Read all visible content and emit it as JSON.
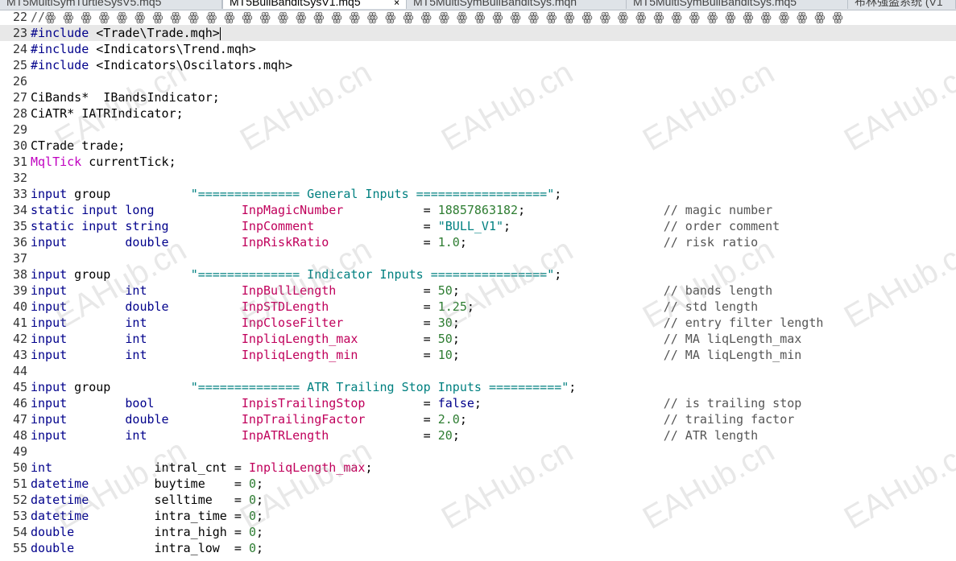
{
  "tabs": [
    {
      "label": "MT5MultiSymTurtleSysV5.mq5",
      "active": false
    },
    {
      "label": "MT5BullBanditSysV1.mq5",
      "active": true
    },
    {
      "label": "MT5MultiSymBullBanditSys.mqh",
      "active": false
    },
    {
      "label": "MT5MultiSymBullBanditSys.mq5",
      "active": false
    },
    {
      "label": "布林强盗系统 (V1",
      "active": false
    }
  ],
  "tab_close_icon": "×",
  "watermark_text": "EAHub.cn",
  "lines": [
    {
      "n": "22",
      "segs": [
        {
          "t": "//ꙮ ꙮ ꙮ ꙮ ꙮ ꙮ ꙮ ꙮ ꙮ ꙮ ꙮ ꙮ ꙮ ꙮ ꙮ ꙮ ꙮ ꙮ ꙮ ꙮ ꙮ ꙮ ꙮ ꙮ ꙮ ꙮ ꙮ ꙮ ꙮ ꙮ ꙮ ꙮ ꙮ ꙮ ꙮ ꙮ ꙮ ꙮ ꙮ ꙮ ꙮ ꙮ ꙮ ꙮ ꙮ",
          "c": "cm"
        }
      ]
    },
    {
      "n": "23",
      "current": true,
      "segs": [
        {
          "t": "#include",
          "c": "pp"
        },
        {
          "t": " <Trade\\Trade.mqh>"
        }
      ]
    },
    {
      "n": "24",
      "segs": [
        {
          "t": "#include",
          "c": "pp"
        },
        {
          "t": " <Indicators\\Trend.mqh>"
        }
      ]
    },
    {
      "n": "25",
      "segs": [
        {
          "t": "#include",
          "c": "pp"
        },
        {
          "t": " <Indicators\\Oscilators.mqh>"
        }
      ]
    },
    {
      "n": "26",
      "segs": []
    },
    {
      "n": "27",
      "segs": [
        {
          "t": "CiBands*  IBandsIndicator;"
        }
      ]
    },
    {
      "n": "28",
      "segs": [
        {
          "t": "CiATR* IATRIndicator;"
        }
      ]
    },
    {
      "n": "29",
      "segs": []
    },
    {
      "n": "30",
      "segs": [
        {
          "t": "CTrade trade;"
        }
      ]
    },
    {
      "n": "31",
      "segs": [
        {
          "t": "MqlTick",
          "c": "mq"
        },
        {
          "t": " currentTick;"
        }
      ]
    },
    {
      "n": "32",
      "segs": []
    },
    {
      "n": "33",
      "segs": [
        {
          "t": "input",
          "c": "kw"
        },
        {
          "t": " group           "
        },
        {
          "t": "\"============== General Inputs ==================\"",
          "c": "st"
        },
        {
          "t": ";"
        }
      ]
    },
    {
      "n": "34",
      "segs": [
        {
          "t": "static",
          "c": "kw"
        },
        {
          "t": " "
        },
        {
          "t": "input",
          "c": "kw"
        },
        {
          "t": " "
        },
        {
          "t": "long",
          "c": "ty"
        },
        {
          "t": "            "
        },
        {
          "t": "InpMagicNumber",
          "c": "id"
        },
        {
          "t": "           = "
        },
        {
          "t": "18857863182",
          "c": "nu"
        },
        {
          "t": ";                   "
        },
        {
          "t": "// magic number",
          "c": "cm"
        }
      ]
    },
    {
      "n": "35",
      "segs": [
        {
          "t": "static",
          "c": "kw"
        },
        {
          "t": " "
        },
        {
          "t": "input",
          "c": "kw"
        },
        {
          "t": " "
        },
        {
          "t": "string",
          "c": "ty"
        },
        {
          "t": "          "
        },
        {
          "t": "InpComment",
          "c": "id"
        },
        {
          "t": "               = "
        },
        {
          "t": "\"BULL_V1\"",
          "c": "st"
        },
        {
          "t": ";                     "
        },
        {
          "t": "// order comment",
          "c": "cm"
        }
      ]
    },
    {
      "n": "36",
      "segs": [
        {
          "t": "input",
          "c": "kw"
        },
        {
          "t": "        "
        },
        {
          "t": "double",
          "c": "ty"
        },
        {
          "t": "          "
        },
        {
          "t": "InpRiskRatio",
          "c": "id"
        },
        {
          "t": "             = "
        },
        {
          "t": "1.0",
          "c": "nu"
        },
        {
          "t": ";                           "
        },
        {
          "t": "// risk ratio",
          "c": "cm"
        }
      ]
    },
    {
      "n": "37",
      "segs": []
    },
    {
      "n": "38",
      "segs": [
        {
          "t": "input",
          "c": "kw"
        },
        {
          "t": " group           "
        },
        {
          "t": "\"============== Indicator Inputs ================\"",
          "c": "st"
        },
        {
          "t": ";"
        }
      ]
    },
    {
      "n": "39",
      "segs": [
        {
          "t": "input",
          "c": "kw"
        },
        {
          "t": "        "
        },
        {
          "t": "int",
          "c": "ty"
        },
        {
          "t": "             "
        },
        {
          "t": "InpBullLength",
          "c": "id"
        },
        {
          "t": "            = "
        },
        {
          "t": "50",
          "c": "nu"
        },
        {
          "t": ";                            "
        },
        {
          "t": "// bands length",
          "c": "cm"
        }
      ]
    },
    {
      "n": "40",
      "segs": [
        {
          "t": "input",
          "c": "kw"
        },
        {
          "t": "        "
        },
        {
          "t": "double",
          "c": "ty"
        },
        {
          "t": "          "
        },
        {
          "t": "InpSTDLength",
          "c": "id"
        },
        {
          "t": "             = "
        },
        {
          "t": "1.25",
          "c": "nu"
        },
        {
          "t": ";                          "
        },
        {
          "t": "// std length",
          "c": "cm"
        }
      ]
    },
    {
      "n": "41",
      "segs": [
        {
          "t": "input",
          "c": "kw"
        },
        {
          "t": "        "
        },
        {
          "t": "int",
          "c": "ty"
        },
        {
          "t": "             "
        },
        {
          "t": "InpCloseFilter",
          "c": "id"
        },
        {
          "t": "           = "
        },
        {
          "t": "30",
          "c": "nu"
        },
        {
          "t": ";                            "
        },
        {
          "t": "// entry filter length",
          "c": "cm"
        }
      ]
    },
    {
      "n": "42",
      "segs": [
        {
          "t": "input",
          "c": "kw"
        },
        {
          "t": "        "
        },
        {
          "t": "int",
          "c": "ty"
        },
        {
          "t": "             "
        },
        {
          "t": "InpliqLength_max",
          "c": "id"
        },
        {
          "t": "         = "
        },
        {
          "t": "50",
          "c": "nu"
        },
        {
          "t": ";                            "
        },
        {
          "t": "// MA liqLength_max",
          "c": "cm"
        }
      ]
    },
    {
      "n": "43",
      "segs": [
        {
          "t": "input",
          "c": "kw"
        },
        {
          "t": "        "
        },
        {
          "t": "int",
          "c": "ty"
        },
        {
          "t": "             "
        },
        {
          "t": "InpliqLength_min",
          "c": "id"
        },
        {
          "t": "         = "
        },
        {
          "t": "10",
          "c": "nu"
        },
        {
          "t": ";                            "
        },
        {
          "t": "// MA liqLength_min",
          "c": "cm"
        }
      ]
    },
    {
      "n": "44",
      "segs": []
    },
    {
      "n": "45",
      "segs": [
        {
          "t": "input",
          "c": "kw"
        },
        {
          "t": " group           "
        },
        {
          "t": "\"============== ATR Trailing Stop Inputs ==========\"",
          "c": "st"
        },
        {
          "t": ";"
        }
      ]
    },
    {
      "n": "46",
      "segs": [
        {
          "t": "input",
          "c": "kw"
        },
        {
          "t": "        "
        },
        {
          "t": "bool",
          "c": "ty"
        },
        {
          "t": "            "
        },
        {
          "t": "InpisTrailingStop",
          "c": "id"
        },
        {
          "t": "        = "
        },
        {
          "t": "false",
          "c": "kw"
        },
        {
          "t": ";                         "
        },
        {
          "t": "// is trailing stop",
          "c": "cm"
        }
      ]
    },
    {
      "n": "47",
      "segs": [
        {
          "t": "input",
          "c": "kw"
        },
        {
          "t": "        "
        },
        {
          "t": "double",
          "c": "ty"
        },
        {
          "t": "          "
        },
        {
          "t": "InpTrailingFactor",
          "c": "id"
        },
        {
          "t": "        = "
        },
        {
          "t": "2.0",
          "c": "nu"
        },
        {
          "t": ";                           "
        },
        {
          "t": "// trailing factor",
          "c": "cm"
        }
      ]
    },
    {
      "n": "48",
      "segs": [
        {
          "t": "input",
          "c": "kw"
        },
        {
          "t": "        "
        },
        {
          "t": "int",
          "c": "ty"
        },
        {
          "t": "             "
        },
        {
          "t": "InpATRLength",
          "c": "id"
        },
        {
          "t": "             = "
        },
        {
          "t": "20",
          "c": "nu"
        },
        {
          "t": ";                            "
        },
        {
          "t": "// ATR length",
          "c": "cm"
        }
      ]
    },
    {
      "n": "49",
      "segs": []
    },
    {
      "n": "50",
      "segs": [
        {
          "t": "int",
          "c": "ty"
        },
        {
          "t": "              intral_cnt = "
        },
        {
          "t": "InpliqLength_max",
          "c": "id"
        },
        {
          "t": ";"
        }
      ]
    },
    {
      "n": "51",
      "segs": [
        {
          "t": "datetime",
          "c": "ty"
        },
        {
          "t": "         buytime    = "
        },
        {
          "t": "0",
          "c": "nu"
        },
        {
          "t": ";"
        }
      ]
    },
    {
      "n": "52",
      "segs": [
        {
          "t": "datetime",
          "c": "ty"
        },
        {
          "t": "         selltime   = "
        },
        {
          "t": "0",
          "c": "nu"
        },
        {
          "t": ";"
        }
      ]
    },
    {
      "n": "53",
      "segs": [
        {
          "t": "datetime",
          "c": "ty"
        },
        {
          "t": "         intra_time = "
        },
        {
          "t": "0",
          "c": "nu"
        },
        {
          "t": ";"
        }
      ]
    },
    {
      "n": "54",
      "segs": [
        {
          "t": "double",
          "c": "ty"
        },
        {
          "t": "           intra_high = "
        },
        {
          "t": "0",
          "c": "nu"
        },
        {
          "t": ";"
        }
      ]
    },
    {
      "n": "55",
      "segs": [
        {
          "t": "double",
          "c": "ty"
        },
        {
          "t": "           intra_low  = "
        },
        {
          "t": "0",
          "c": "nu"
        },
        {
          "t": ";"
        }
      ]
    }
  ]
}
